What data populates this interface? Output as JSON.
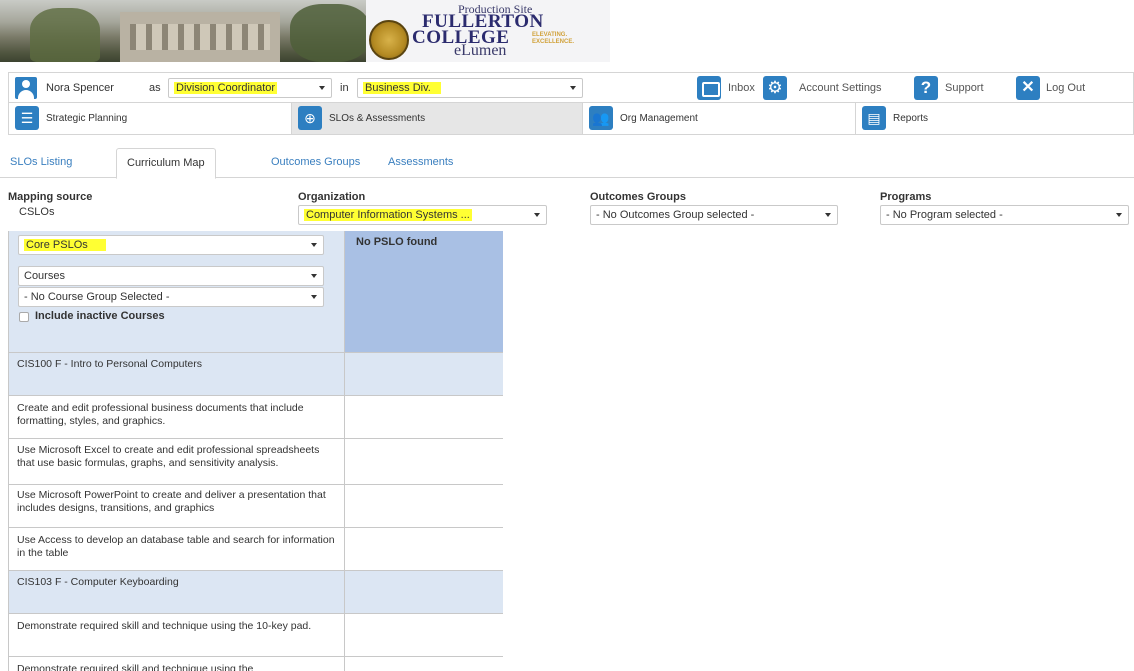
{
  "banner": {
    "production_site": "Production Site",
    "college_name_line1": "FULLERTON",
    "college_name_line2": "COLLEGE",
    "tagline_line1": "ELEVATING.",
    "tagline_line2": "EXCELLENCE.",
    "product": "eLumen"
  },
  "userbar": {
    "user_name": "Nora Spencer",
    "as_label": "as",
    "role": "Division Coordinator",
    "in_label": "in",
    "division": "Business Div.",
    "inbox": "Inbox",
    "account_settings": "Account Settings",
    "support": "Support",
    "logout": "Log Out"
  },
  "mainnav": {
    "items": [
      {
        "label": "Strategic Planning"
      },
      {
        "label": "SLOs & Assessments"
      },
      {
        "label": "Org Management"
      },
      {
        "label": "Reports"
      }
    ],
    "active_index": 1
  },
  "subtabs": {
    "items": [
      {
        "label": "SLOs Listing"
      },
      {
        "label": "Curriculum Map"
      },
      {
        "label": "Outcomes Groups"
      },
      {
        "label": "Assessments"
      }
    ],
    "active_index": 1
  },
  "filters": {
    "mapping_source_label": "Mapping source",
    "mapping_source_value": "CSLOs",
    "organization_label": "Organization",
    "organization_value": "Computer Information Systems ...",
    "outcomes_groups_label": "Outcomes Groups",
    "outcomes_groups_value": "- No Outcomes Group selected -",
    "programs_label": "Programs",
    "programs_value": "- No Program selected -"
  },
  "map": {
    "pslo_select": "Core PSLOs",
    "courses_select": "Courses",
    "course_group_select": "- No Course Group Selected -",
    "include_inactive_label": "Include inactive Courses",
    "no_pslo_text": "No PSLO found",
    "rows": [
      {
        "type": "course",
        "text": "CIS100 F - Intro to Personal Computers"
      },
      {
        "type": "slo",
        "text": "Create and edit professional business documents that include formatting, styles, and graphics."
      },
      {
        "type": "slo",
        "text": "Use Microsoft Excel to create and edit professional spreadsheets that use basic formulas, graphs, and sensitivity analysis."
      },
      {
        "type": "slo",
        "text": "Use Microsoft PowerPoint to create and deliver a presentation that includes designs, transitions, and graphics"
      },
      {
        "type": "slo",
        "text": "Use Access to develop an database table and search for information in the table"
      },
      {
        "type": "course",
        "text": "CIS103 F - Computer Keyboarding"
      },
      {
        "type": "slo",
        "text": "Demonstrate required skill and technique using the 10-key pad."
      },
      {
        "type": "slo",
        "text": "Demonstrate required skill and technique using the"
      }
    ]
  },
  "colors": {
    "accent": "#2d7fc1",
    "highlight": "#ffff33",
    "header_light": "#dce6f3",
    "header_dark": "#a9c0e4"
  }
}
